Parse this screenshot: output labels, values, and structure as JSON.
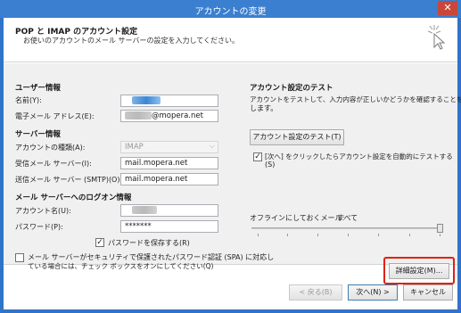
{
  "window": {
    "title": "アカウントの変更",
    "close_glyph": "✕"
  },
  "header": {
    "title": "POP と IMAP のアカウント設定",
    "subtitle": "お使いのアカウントのメール サーバーの設定を入力してください。"
  },
  "user_info": {
    "section": "ユーザー情報",
    "name_label": "名前(Y):",
    "email_label": "電子メール アドレス(E):",
    "email_value": "@mopera.net"
  },
  "server_info": {
    "section": "サーバー情報",
    "account_type_label": "アカウントの種類(A):",
    "account_type_value": "IMAP",
    "incoming_label": "受信メール サーバー(I):",
    "incoming_value": "mail.mopera.net",
    "outgoing_label": "送信メール サーバー (SMTP)(O):",
    "outgoing_value": "mail.mopera.net"
  },
  "logon_info": {
    "section": "メール サーバーへのログオン情報",
    "account_name_label": "アカウント名(U):",
    "password_label": "パスワード(P):",
    "password_value": "*******",
    "remember_password_label": "パスワードを保存する(R)",
    "remember_password_checked": true,
    "spa_label_line1": "メール サーバーがセキュリティで保護されたパスワード認証 (SPA) に対応し",
    "spa_label_line2": "ている場合には、チェック ボックスをオンにしてください(Q)",
    "spa_checked": false
  },
  "test_settings": {
    "section": "アカウント設定のテスト",
    "desc_line1": "アカウントをテストして、入力内容が正しいかどうかを確認することをお勧め",
    "desc_line2": "します。",
    "test_button": "アカウント設定のテスト(T)",
    "auto_test_line1": "[次へ] をクリックしたらアカウント設定を自動的にテストする",
    "auto_test_line2": "(S)",
    "auto_test_checked": true
  },
  "offline": {
    "label": "オフラインにしておくメール:",
    "value": "すべて"
  },
  "more_settings_button": "詳細設定(M)...",
  "footer": {
    "back_button": "< 戻る(B)",
    "next_button": "次へ(N) >",
    "cancel_button": "キャンセル"
  },
  "colors": {
    "titlebar": "#3b7fd0",
    "highlight": "#e2200f"
  }
}
